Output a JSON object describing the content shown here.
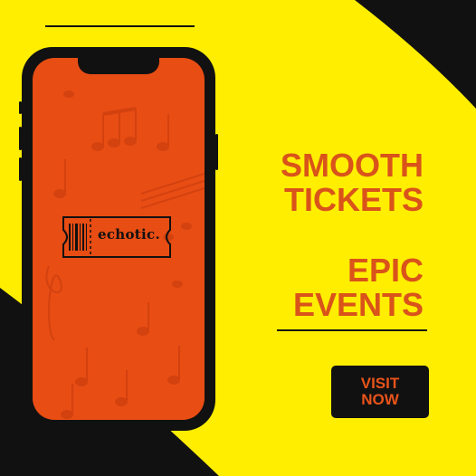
{
  "headline": {
    "line1": "SMOOTH",
    "line2": "TICKETS",
    "line3": "EPIC",
    "line4": "EVENTS"
  },
  "phone": {
    "brand": "echotic."
  },
  "cta": {
    "line1": "VISIT",
    "line2": "NOW"
  },
  "colors": {
    "background": "#ffee00",
    "accent": "#e84d14",
    "dark": "#111111"
  },
  "icons": [
    "music-note-icon",
    "barcode-icon",
    "treble-clef-icon"
  ]
}
